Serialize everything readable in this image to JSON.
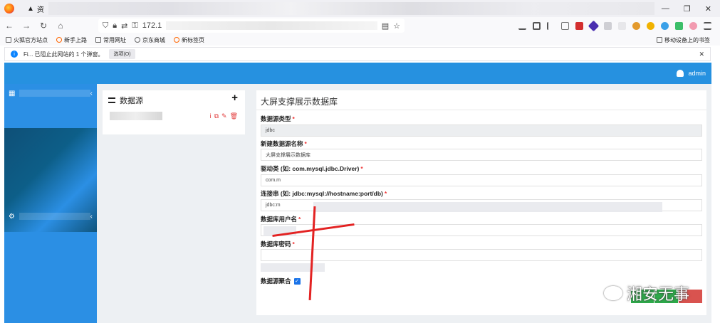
{
  "browser": {
    "tab_title": "资",
    "url_prefix": "172.1",
    "window_controls": [
      "—",
      "❐",
      "✕"
    ]
  },
  "bookmarks": [
    "火狐官方站点",
    "新手上路",
    "常用网址",
    "京东商城",
    "新标签页"
  ],
  "bookmarks_right": "移动设备上的书签",
  "infobar": {
    "text": "Fi... 已阻止此网站的 1 个弹窗。",
    "button": "选项(O)",
    "close": "✕"
  },
  "header": {
    "user": "admin"
  },
  "datasource": {
    "title": "数据源",
    "add": "+",
    "actions": [
      "i",
      "⧉",
      "✎",
      "🗑"
    ]
  },
  "form": {
    "title": "大屏支撑展示数据库",
    "fields": [
      {
        "label": "数据源类型",
        "value": "jdbc",
        "required": true
      },
      {
        "label": "新建数据源名称",
        "value": "大屏支撑展示数据库",
        "required": true
      },
      {
        "label": "驱动类 (如: com.mysql.jdbc.Driver)",
        "value": "com.m",
        "required": true
      },
      {
        "label": "连接串 (如: jdbc:mysql://hostname:port/db)",
        "value": "jdbc:m",
        "required": true
      },
      {
        "label": "数据库用户名",
        "value": "",
        "required": true
      },
      {
        "label": "数据库密码",
        "value": "",
        "required": true
      }
    ],
    "checkbox_label": "数据源聚合",
    "checkbox_checked": true
  },
  "watermark": "湘安无事",
  "colors": {
    "header": "#2691e0",
    "sidebar": "#2b8fe4",
    "danger": "#e23c3c",
    "success": "#2daa4a"
  }
}
